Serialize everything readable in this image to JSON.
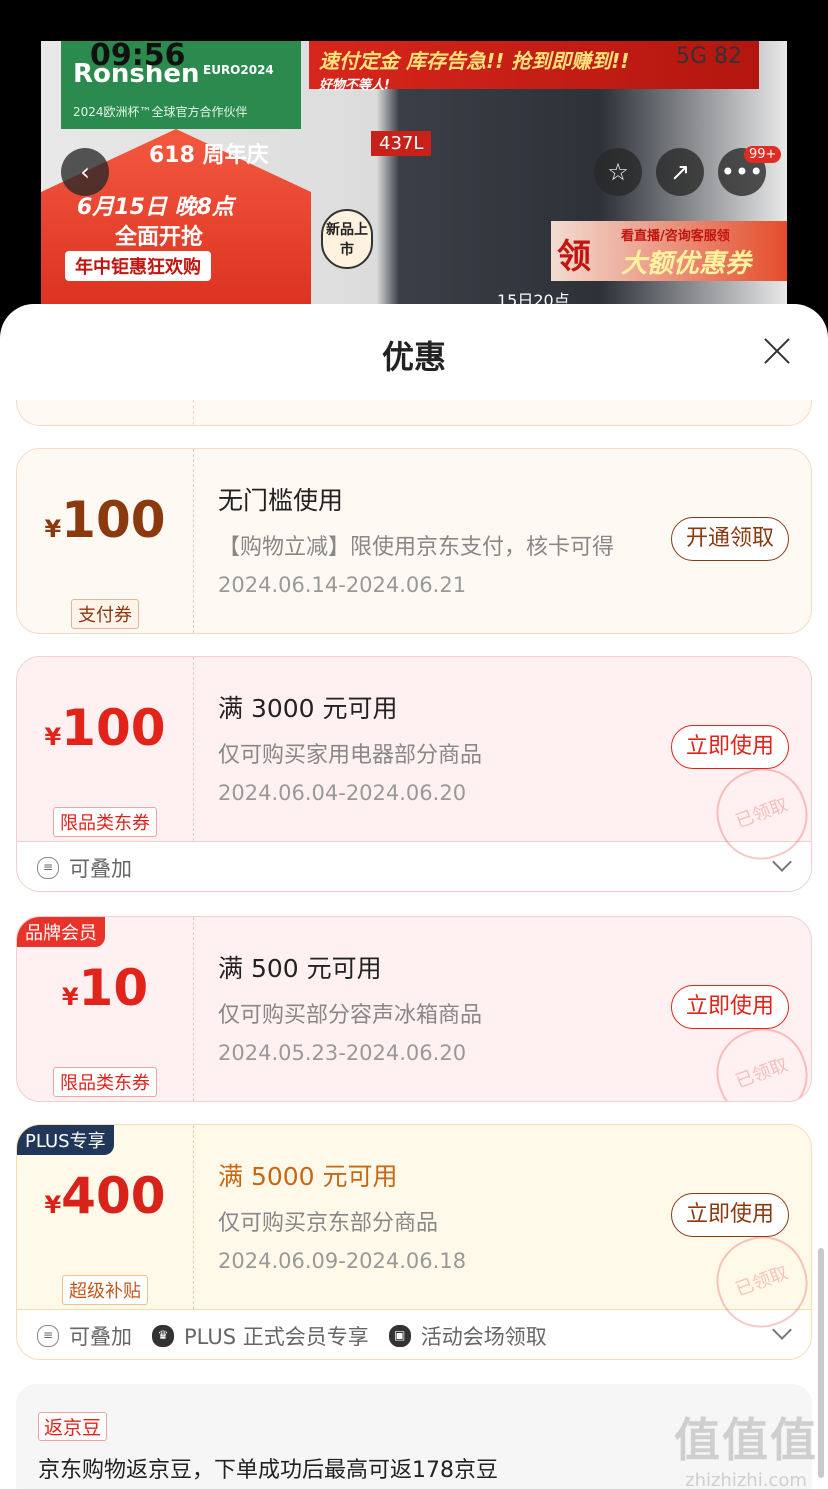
{
  "status": {
    "time": "09:56",
    "network": "5G",
    "battery": "82"
  },
  "banner": {
    "brand": "Ronshen",
    "brand_sub": "2024欧洲杯™全球官方合作伙伴",
    "euro": "EURO2024",
    "headline": "速付定金 库存告急!! 抢到即赚到!!",
    "headline_sub": "好物不等人!",
    "capacity": "437L",
    "promo_618": "618 周年庆",
    "promo_date": "6月15日 晚8点",
    "promo_start": "全面开抢",
    "promo_year": "年中钜惠狂欢购",
    "new_tag": "新品上市",
    "live_ling": "领",
    "live_top": "看直播/咨询客服领",
    "live_main": "大额优惠券",
    "date_strip": "15日20点",
    "back_icon": "‹",
    "star_icon": "☆",
    "share_icon": "↗",
    "more_icon": "•••",
    "cart_count": "99+"
  },
  "sheet": {
    "title": "优惠"
  },
  "coupons": [
    {
      "yen": "¥",
      "amount": "100",
      "tag": "支付券",
      "title": "无门槛使用",
      "desc": "【购物立减】限使用京东支付，核卡可得",
      "date": "2024.06.14-2024.06.21",
      "button": "开通领取"
    },
    {
      "yen": "¥",
      "amount": "100",
      "tag": "限品类东券",
      "title": "满 3000 元可用",
      "desc": "仅可购买家用电器部分商品",
      "date": "2024.06.04-2024.06.20",
      "button": "立即使用",
      "stamp": "已领取",
      "footer": [
        "可叠加"
      ]
    },
    {
      "ribbon": "品牌会员",
      "yen": "¥",
      "amount": "10",
      "tag": "限品类东券",
      "title": "满 500 元可用",
      "desc": "仅可购买部分容声冰箱商品",
      "date": "2024.05.23-2024.06.20",
      "button": "立即使用",
      "stamp": "已领取"
    },
    {
      "ribbon": "PLUS专享",
      "yen": "¥",
      "amount": "400",
      "tag": "超级补贴",
      "title": "满 5000 元可用",
      "desc": "仅可购买京东部分商品",
      "date": "2024.06.09-2024.06.18",
      "button": "立即使用",
      "stamp": "已领取",
      "footer": [
        "可叠加",
        "PLUS 正式会员专享",
        "活动会场领取"
      ]
    }
  ],
  "jingdou": {
    "tag": "返京豆",
    "text": "京东购物返京豆，下单成功后最高可返178京豆"
  },
  "watermark": {
    "big": "值值值",
    "small": "zhizhizhi.com"
  },
  "colors": {
    "red": "#e2231a",
    "brown": "#8b3a10",
    "gold": "#c86813",
    "plus": "#21375a"
  }
}
